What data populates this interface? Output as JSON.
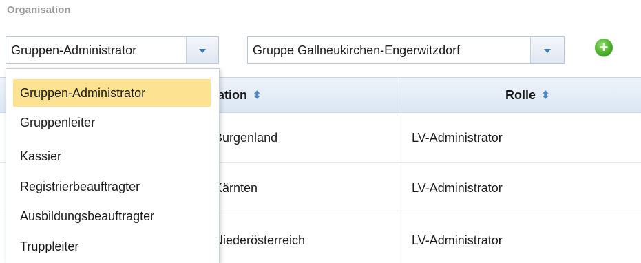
{
  "section": {
    "title": "Organisation"
  },
  "role_select": {
    "value": "Gruppen-Administrator",
    "options": [
      "Gruppen-Administrator",
      "Gruppenleiter",
      "Kassier",
      "Registrierbeauftragter",
      "Ausbildungsbeauftragter",
      "Truppleiter"
    ],
    "selected_index": 0
  },
  "group_select": {
    "value": "Gruppe Gallneukirchen-Engerwitzdorf"
  },
  "add_button": {
    "icon": "plus-circle-icon",
    "color": "#4cb02a"
  },
  "table": {
    "columns": {
      "organisation": "Organisation",
      "rolle": "Rolle"
    },
    "visible_column_header_fragment": "nisation",
    "rows": [
      {
        "organisation_visible": "d Burgenland",
        "rolle": "LV-Administrator"
      },
      {
        "organisation_visible": "d Kärnten",
        "rolle": "LV-Administrator"
      },
      {
        "organisation_visible": "d Niederösterreich",
        "rolle": "LV-Administrator"
      }
    ]
  },
  "colors": {
    "selected_option_bg": "#fde391",
    "header_bg": "#dbe6f3",
    "accent": "#3b78c2"
  }
}
